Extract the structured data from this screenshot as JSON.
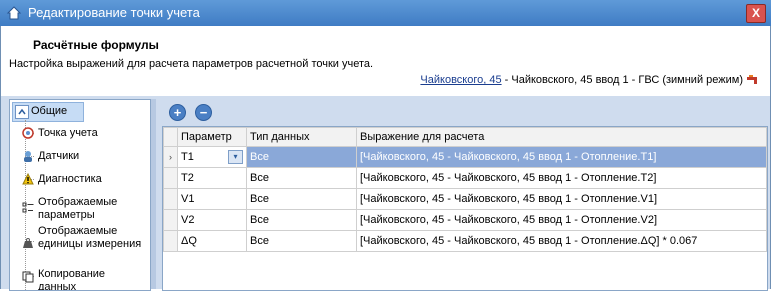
{
  "window": {
    "title": "Редактирование точки учета",
    "close_label": "X"
  },
  "header": {
    "title": "Расчётные формулы",
    "subtitle": "Настройка выражений для расчета параметров расчетной точки учета.",
    "breadcrumb_link": "Чайковского, 45",
    "breadcrumb_rest": " - Чайковского, 45 ввод 1 - ГВС (зимний режим)"
  },
  "nav": {
    "group_label": "Общие",
    "items": [
      {
        "label": "Точка учета",
        "icon": "meter-icon"
      },
      {
        "label": "Датчики",
        "icon": "user-icon"
      },
      {
        "label": "Диагностика",
        "icon": "warning-icon"
      },
      {
        "label": "Отображаемые параметры",
        "icon": "list-icon"
      },
      {
        "label": "Отображаемые единицы измерения",
        "icon": "weight-icon"
      },
      {
        "label": "Копирование данных",
        "icon": "copy-icon"
      }
    ]
  },
  "toolbar": {
    "add_label": "+",
    "remove_label": "−"
  },
  "table": {
    "columns": [
      "Параметр",
      "Тип данных",
      "Выражение для расчета"
    ],
    "rows": [
      {
        "param": "T1",
        "type": "Все",
        "expr": "[Чайковского, 45 - Чайковского, 45 ввод 1 - Отопление.T1]",
        "selected": true
      },
      {
        "param": "T2",
        "type": "Все",
        "expr": "[Чайковского, 45 - Чайковского, 45 ввод 1 - Отопление.T2]"
      },
      {
        "param": "V1",
        "type": "Все",
        "expr": "[Чайковского, 45 - Чайковского, 45 ввод 1 - Отопление.V1]"
      },
      {
        "param": "V2",
        "type": "Все",
        "expr": "[Чайковского, 45 - Чайковского, 45 ввод 1 - Отопление.V2]"
      },
      {
        "param": "ΔQ",
        "type": "Все",
        "expr": "[Чайковского, 45 - Чайковского, 45 ввод 1 - Отопление.ΔQ] * 0.067"
      }
    ],
    "current_row_marker": "›",
    "dropdown_glyph": "▾"
  },
  "colors": {
    "titlebar": "#4a86cc",
    "selection": "#8aa8d8",
    "panel_bg": "#cfdcee"
  }
}
